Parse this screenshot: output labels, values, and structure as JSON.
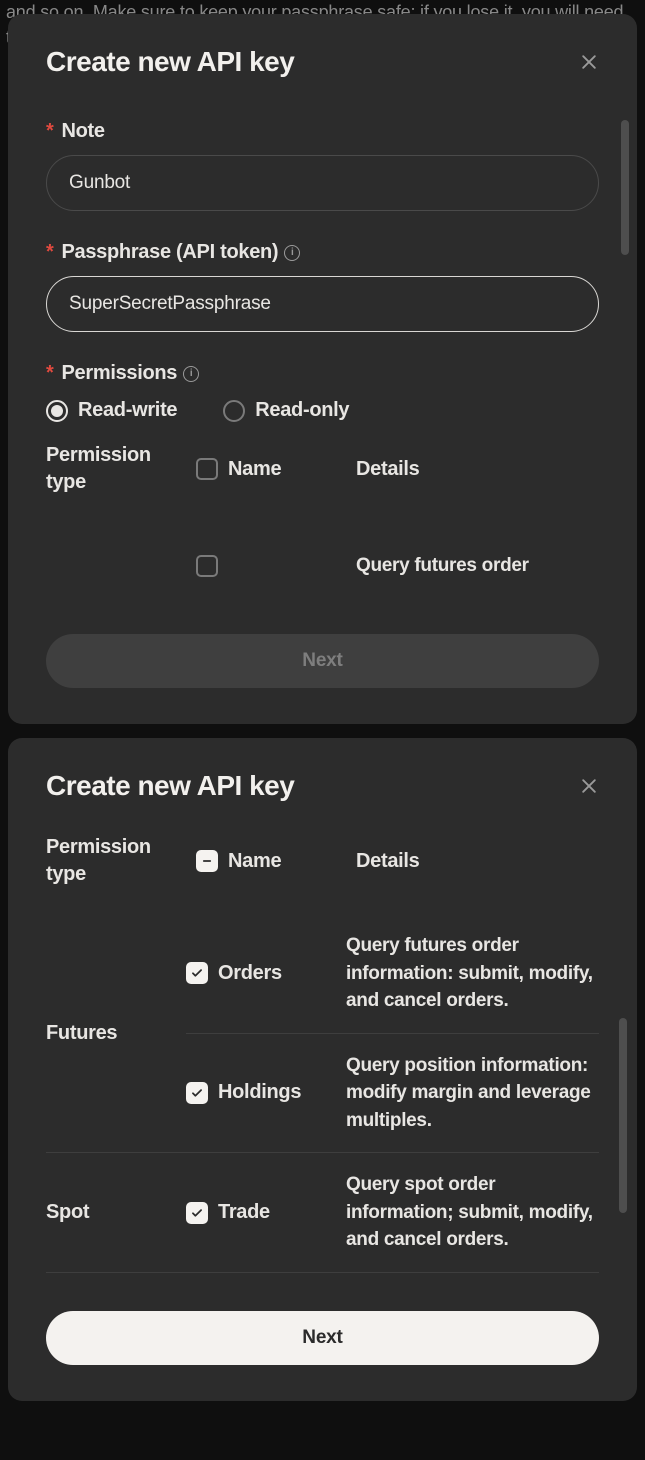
{
  "bg_text": "and so on. Make sure to keep your passphrase safe; if you lose it, you will need to create a new key. For additional details, you can use the documentation.",
  "modal1": {
    "title": "Create new API key",
    "note_label": "Note",
    "note_value": "Gunbot",
    "passphrase_label": "Passphrase (API token)",
    "passphrase_value": "SuperSecretPassphrase",
    "permissions_label": "Permissions",
    "radio_rw": "Read-write",
    "radio_ro": "Read-only",
    "col_type": "Permission type",
    "col_name": "Name",
    "col_details": "Details",
    "peek_details": "Query futures order",
    "next_label": "Next"
  },
  "modal2": {
    "title": "Create new API key",
    "col_type": "Permission type",
    "col_name": "Name",
    "col_details": "Details",
    "groups": [
      {
        "type": "Futures",
        "rows": [
          {
            "name": "Orders",
            "details": "Query futures order information: submit, modify, and cancel orders."
          },
          {
            "name": "Holdings",
            "details": "Query position information: modify margin and leverage multiples."
          }
        ]
      },
      {
        "type": "Spot",
        "rows": [
          {
            "name": "Trade",
            "details": "Query spot order information; submit, modify, and cancel orders."
          }
        ]
      }
    ],
    "next_label": "Next"
  }
}
